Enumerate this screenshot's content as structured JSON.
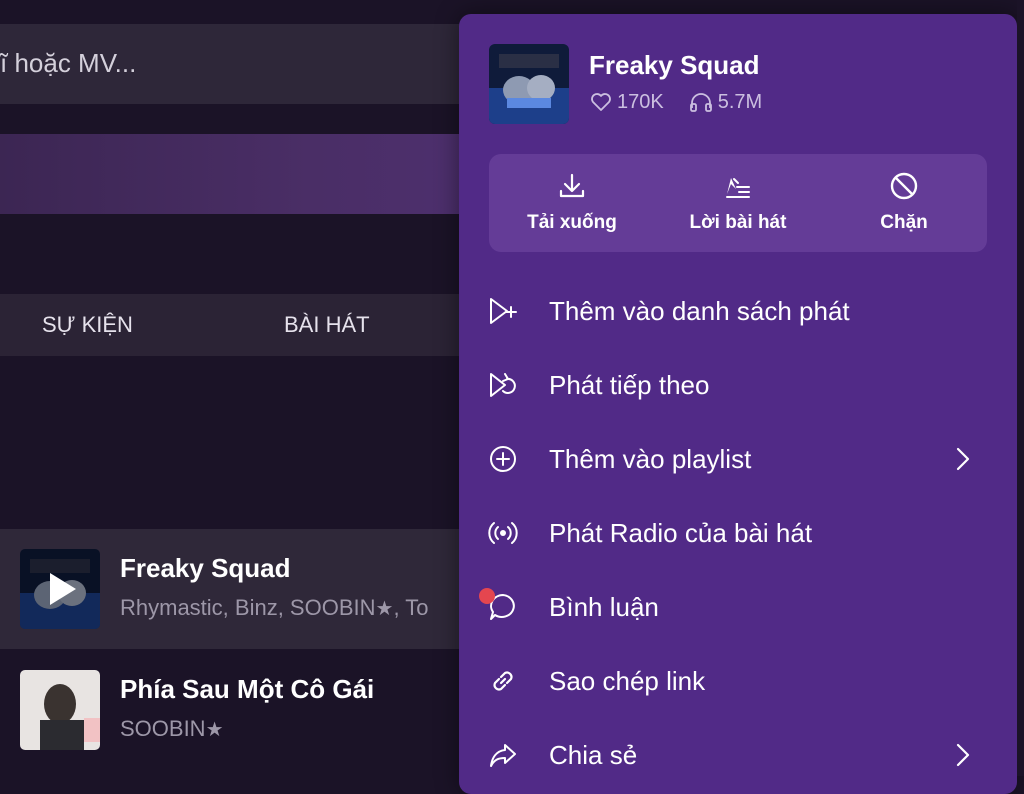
{
  "search": {
    "placeholder_text": "ĩ hoặc MV..."
  },
  "tabs": [
    {
      "label": "SỰ KIỆN"
    },
    {
      "label": "BÀI HÁT"
    }
  ],
  "songs": [
    {
      "title": "Freaky Squad",
      "artist": "Rhymastic, Binz, SOOBIN",
      "artist_tail": ", To"
    },
    {
      "title": "Phía Sau Một Cô Gái",
      "artist": "SOOBIN"
    }
  ],
  "menu": {
    "title": "Freaky Squad",
    "likes": "170K",
    "listens": "5.7M",
    "actions": [
      {
        "label": "Tải xuống",
        "icon": "download-icon"
      },
      {
        "label": "Lời bài hát",
        "icon": "lyrics-icon"
      },
      {
        "label": "Chặn",
        "icon": "block-icon"
      }
    ],
    "items": [
      {
        "label": "Thêm vào danh sách phát",
        "icon": "add-to-queue-icon"
      },
      {
        "label": "Phát tiếp theo",
        "icon": "play-next-icon"
      },
      {
        "label": "Thêm vào playlist",
        "icon": "add-circle-icon",
        "has_submenu": true
      },
      {
        "label": "Phát Radio của bài hát",
        "icon": "radio-icon"
      },
      {
        "label": "Bình luận",
        "icon": "comment-icon",
        "has_notification": true
      },
      {
        "label": "Sao chép link",
        "icon": "link-icon"
      },
      {
        "label": "Chia sẻ",
        "icon": "share-icon",
        "has_submenu": true
      }
    ]
  },
  "colors": {
    "background": "#1b1327",
    "menu_background": "#512a87",
    "action_panel": "#643c97",
    "notification_dot": "#e5464f",
    "secondary_text": "#9d97a8"
  }
}
